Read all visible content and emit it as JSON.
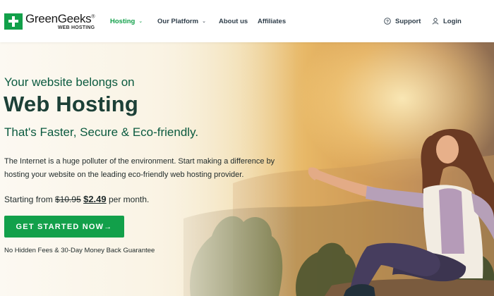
{
  "logo": {
    "name": "GreenGeeks",
    "registered": "®",
    "subtitle": "WEB HOSTING"
  },
  "nav": {
    "hosting": "Hosting",
    "platform": "Our Platform",
    "about": "About us",
    "affiliates": "Affiliates"
  },
  "utility": {
    "support": "Support",
    "login": "Login"
  },
  "hero": {
    "title_small": "Your website belongs on",
    "title_large": "Web Hosting",
    "title_sub": "That's Faster, Secure & Eco-friendly.",
    "description": "The Internet is a huge polluter of the environment. Start making a difference by hosting your website on the leading eco-friendly web hosting provider.",
    "price_prefix": "Starting from",
    "price_old": "$10.95",
    "price_new": "$2.49",
    "price_suffix": "per month.",
    "cta": "GET STARTED NOW→",
    "guarantee": "No Hidden Fees & 30-Day Money Back Guarantee"
  },
  "colors": {
    "brand_green": "#12a04a",
    "heading_dark": "#1c4037",
    "heading_green": "#0b5a3f",
    "nav_text": "#2f3e4a"
  },
  "icons": {
    "logo": "plus-icon",
    "dropdown": "chevron-down-icon",
    "support": "question-circle-icon",
    "login": "user-icon"
  }
}
